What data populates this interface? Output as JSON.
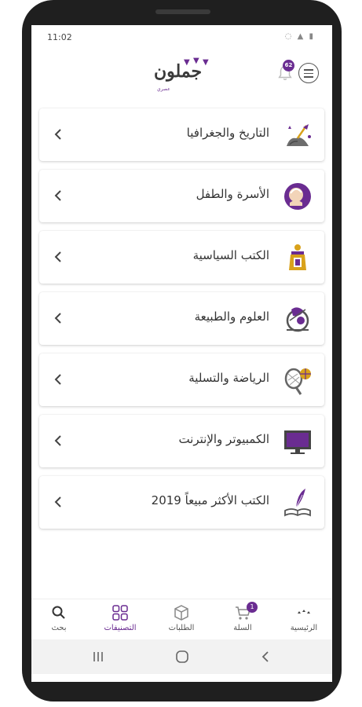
{
  "status_bar": {
    "time": "11:02",
    "icons": "◌ ▲ ▮"
  },
  "header": {
    "logo_text": "جملون",
    "logo_sub": "عصري",
    "notification_count": "62"
  },
  "categories": [
    {
      "label": "التاريخ والجغرافيا",
      "icon": "history-geography-icon"
    },
    {
      "label": "الأسرة والطفل",
      "icon": "family-child-icon"
    },
    {
      "label": "الكتب السياسية",
      "icon": "politics-icon"
    },
    {
      "label": "العلوم والطبيعة",
      "icon": "science-nature-icon"
    },
    {
      "label": "الرياضة والتسلية",
      "icon": "sports-entertainment-icon"
    },
    {
      "label": "الكمبيوتر والإنترنت",
      "icon": "computer-internet-icon"
    },
    {
      "label": "الكتب الأكثر مبيعاً 2019",
      "icon": "bestsellers-icon"
    }
  ],
  "bottom_nav": {
    "home": "الرئيسية",
    "cart": "السلة",
    "cart_count": "1",
    "orders": "الطلبات",
    "categories": "التصنيفات",
    "search": "بحث"
  },
  "colors": {
    "accent": "#6a2c91",
    "text": "#333333",
    "icon_gray": "#777777"
  }
}
